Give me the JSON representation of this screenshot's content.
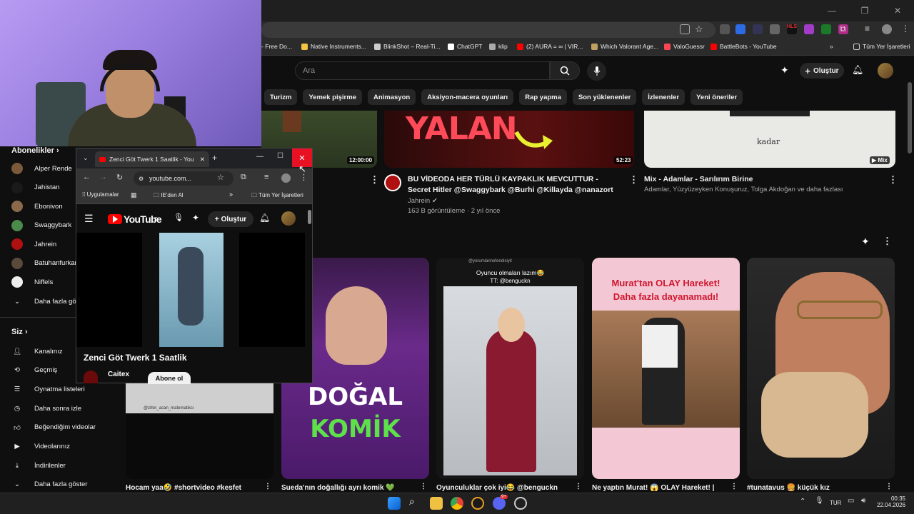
{
  "browser": {
    "bookmarks": [
      {
        "label": "- Free Do...",
        "color": "#e8e8e8"
      },
      {
        "label": "Native Instruments...",
        "color": "#f5c542"
      },
      {
        "label": "BlinkShot – Real-Ti...",
        "color": "#cccccc"
      },
      {
        "label": "ChatGPT",
        "color": "#ffffff"
      },
      {
        "label": "klip",
        "color": "#aaaaaa"
      },
      {
        "label": "(2) AURA = ∞ | VIR...",
        "color": "#ff0000"
      },
      {
        "label": "Which Valorant Age...",
        "color": "#c0a060"
      },
      {
        "label": "ValoGuessr",
        "color": "#ff4655"
      },
      {
        "label": "BattleBots - YouTube",
        "color": "#ff0000"
      }
    ],
    "bookmarks_more": "»",
    "all_bookmarks": "Tüm Yer İşaretleri"
  },
  "youtube": {
    "search_placeholder": "Ara",
    "create_label": "Oluştur",
    "chips": [
      "Turizm",
      "Yemek pişirme",
      "Animasyon",
      "Aksiyon-macera oyunları",
      "Rap yapma",
      "Son yüklenenler",
      "İzlenenler",
      "Yeni öneriler"
    ]
  },
  "sidebar": {
    "subscriptions_title": "Abonelikler",
    "channels": [
      {
        "name": "Alper Rende",
        "color": "#7a5a3a"
      },
      {
        "name": "Jahistan",
        "color": "#1a1a1a"
      },
      {
        "name": "Ebonivon",
        "color": "#8a6a4a"
      },
      {
        "name": "Swaggybark",
        "color": "#4a8a4a"
      },
      {
        "name": "Jahrein",
        "color": "#b01010"
      },
      {
        "name": "Batuhanfurkan",
        "color": "#5a4a3a"
      },
      {
        "name": "Niffels",
        "color": "#eeeeee"
      }
    ],
    "show_more": "Daha fazla gö",
    "you_title": "Siz",
    "you_items": [
      "Kanalınız",
      "Geçmiş",
      "Oynatma listeleri",
      "Daha sonra izle",
      "Beğendiğim videolar",
      "Videolarınız",
      "İndirilenler",
      "Daha fazla göster"
    ]
  },
  "videos": [
    {
      "duration": "12:00:00"
    },
    {
      "duration": "52:23",
      "thumb_text": "YALAN",
      "title": "BU VİDEODA HER TÜRLÜ KAYPAKLIK MEVCUTTUR - Secret Hitler @Swaggybark @Burhi @Killayda @nanazort",
      "channel": "Jahrein",
      "meta": "163 B görüntüleme · 2 yıl önce"
    },
    {
      "badge": "Mix",
      "thumb_text": "kadar",
      "title": "Mix - Adamlar - Sarılırım Birine",
      "channel": "Adamlar, Yüzyüzeyken Konuşuruz, Tolga Akdoğan ve daha fazlası"
    }
  ],
  "shorts": [
    {
      "title": "Hocam yaa🤣 #shortvideo #kesfet",
      "overlay": "@zihin_acan_matematikci"
    },
    {
      "title": "Sueda'nın doğallığı ayrı komik 💚",
      "overlay_top": "DOĞAL",
      "overlay_bottom": "KOMİK"
    },
    {
      "title": "Oyunculuklar çok iyi😂 @benguckn",
      "overlay_top": "Oyuncu olmaları lazım😂",
      "overlay_sub": "TT: @benguckn",
      "handle": "@yorumlarinefendisiyit"
    },
    {
      "title": "Ne yaptın Murat! 😱 OLAY Hareket! |",
      "overlay_top": "Murat'tan OLAY Hareket!",
      "overlay_sub": "Daha fazla dayanamadı!"
    },
    {
      "title": "#tunatavus 🍔 küçük kız"
    }
  ],
  "mini_window": {
    "tab_title": "Zenci Göt Twerk 1 Saatlik - You",
    "url": "youtube.com...",
    "bookmarks": [
      "Uygulamalar",
      "IE'den Al",
      "Tüm Yer İşaretleri"
    ],
    "logo": "YouTube",
    "create_label": "Oluştur",
    "video_title": "Zenci Göt Twerk 1 Saatlik",
    "channel": "Caitex",
    "subscribe": "Abone ol"
  },
  "taskbar": {
    "lang": "TUR",
    "time": "00:35",
    "date": "22.04.2026",
    "discord_badge": "9+"
  }
}
